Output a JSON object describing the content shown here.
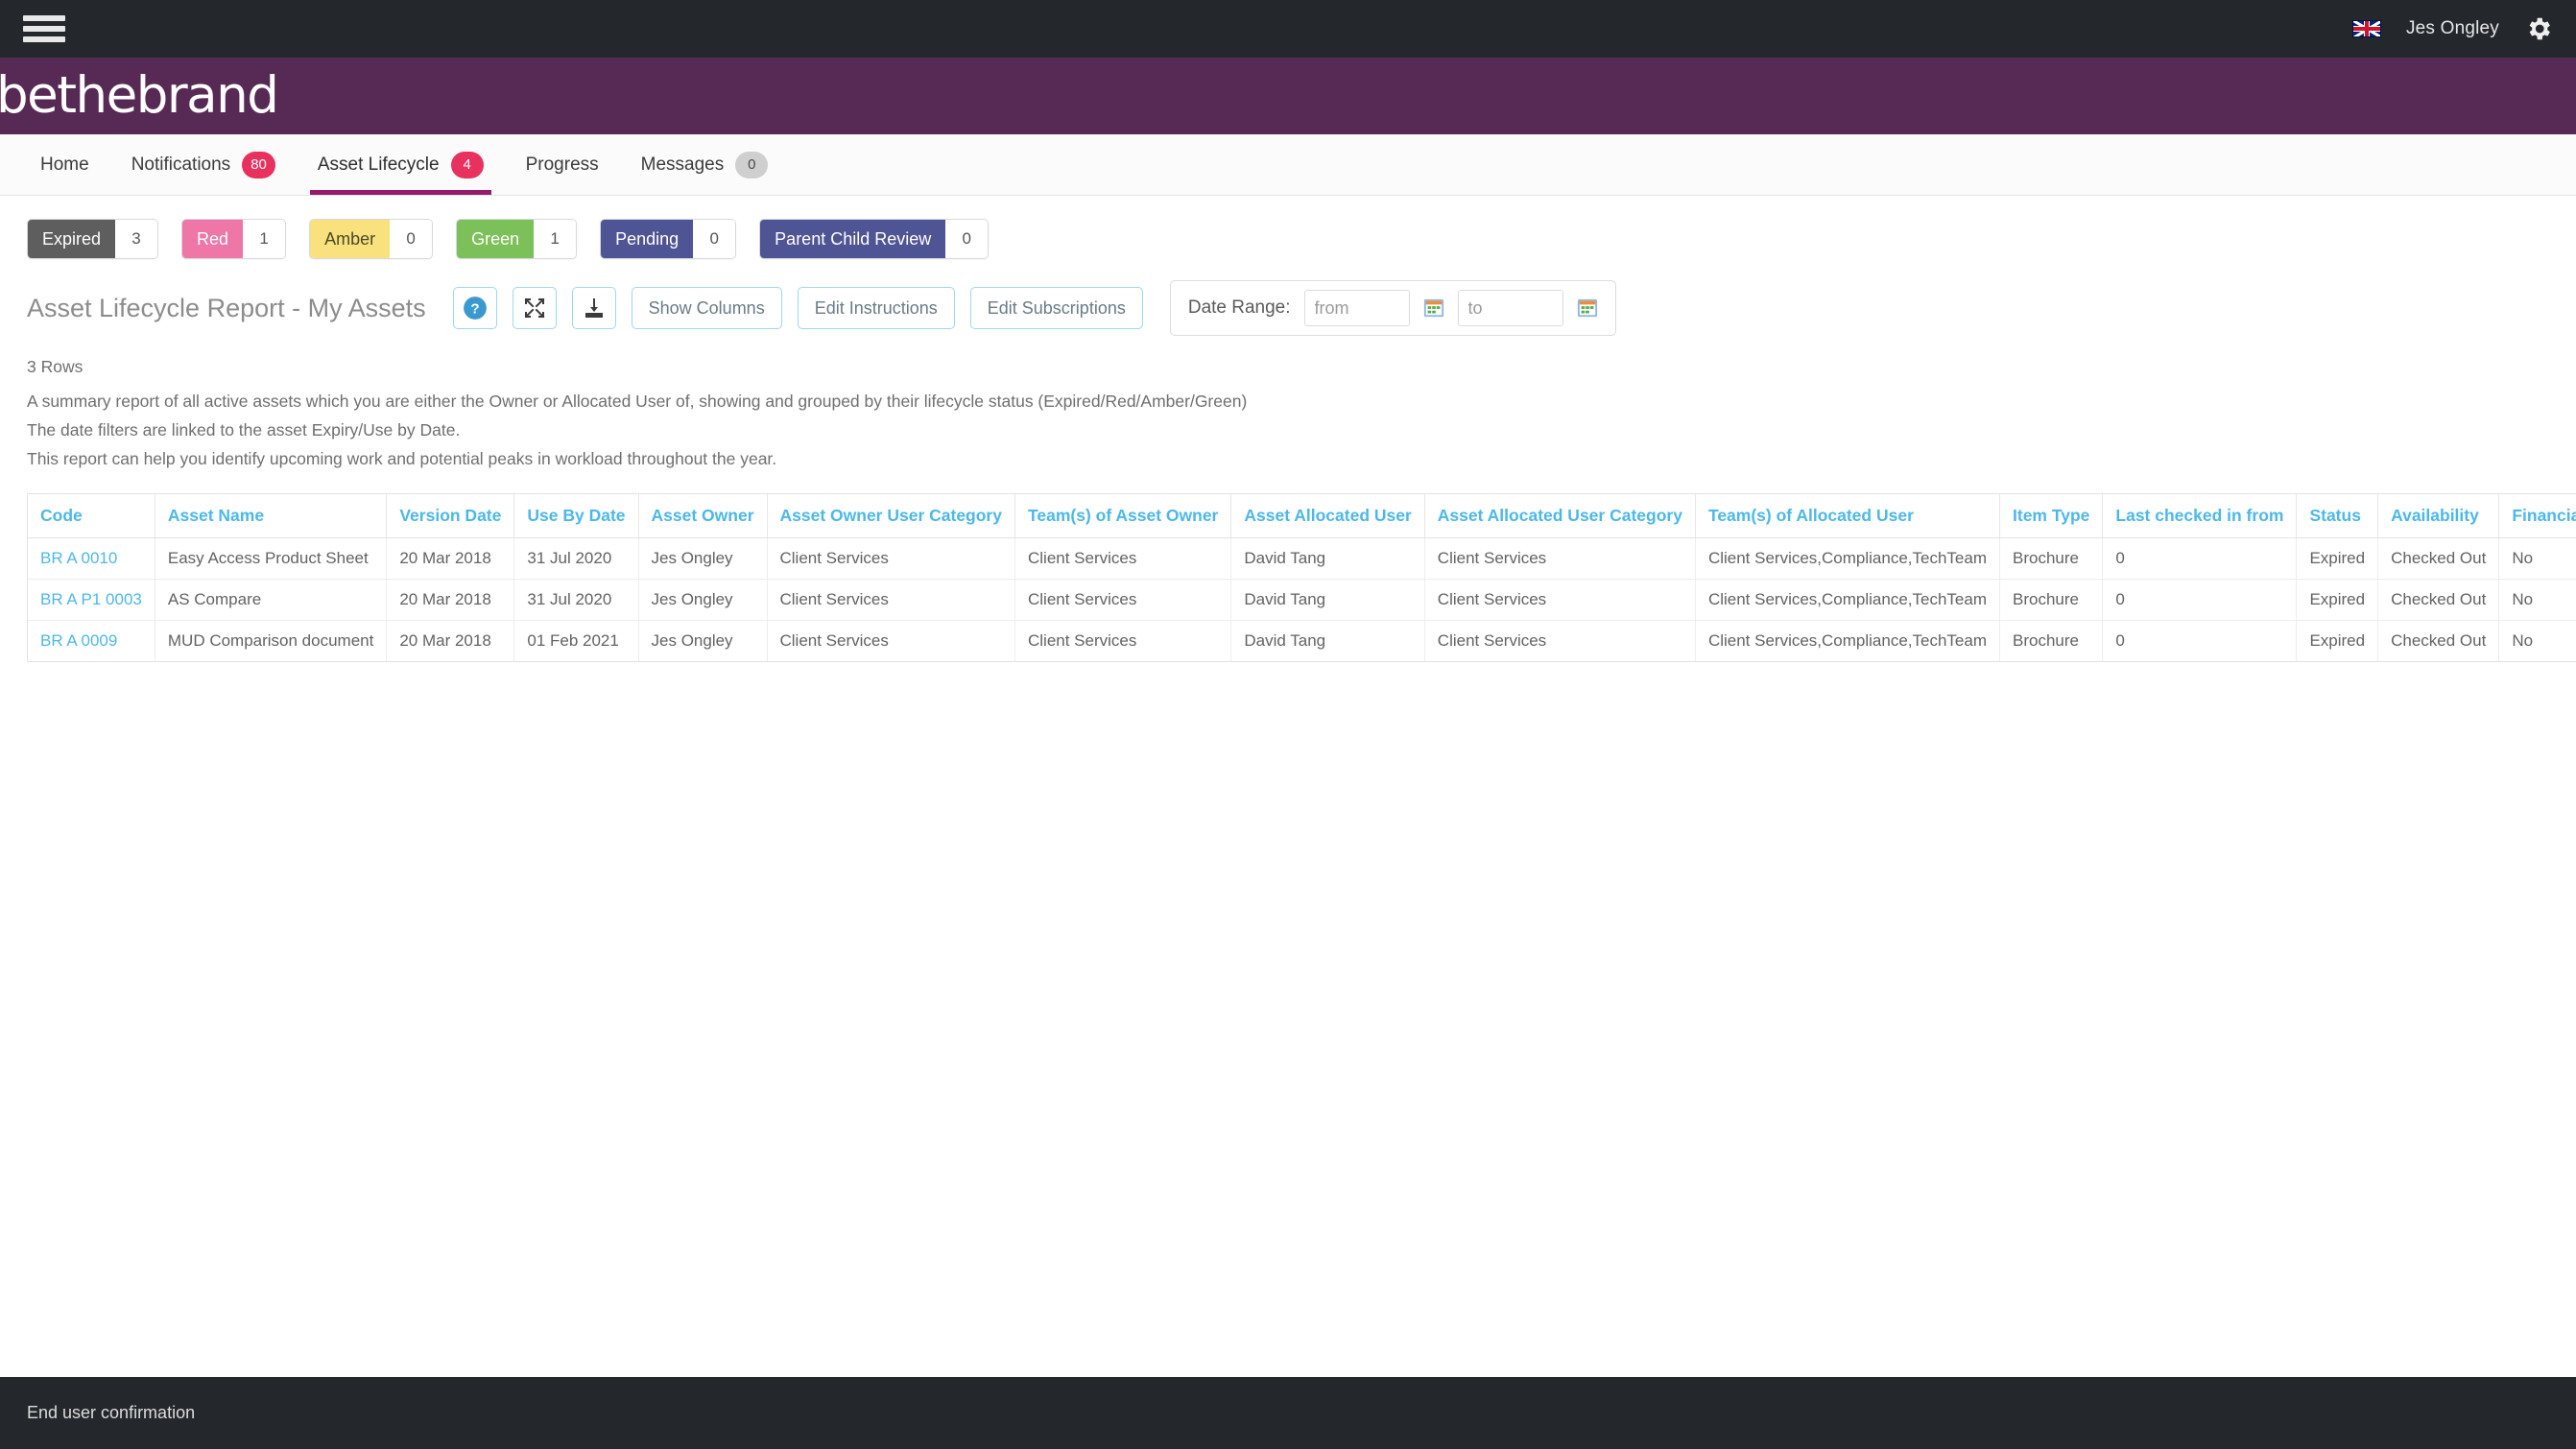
{
  "topbar": {
    "menu_icon": "hamburger-icon",
    "language_flag": "uk-flag-icon",
    "username": "Jes Ongley",
    "settings_icon": "gear-icon"
  },
  "brand": {
    "logo_text": "bethebrand"
  },
  "nav": {
    "tabs": [
      {
        "label": "Home",
        "badge": null,
        "badge_style": null,
        "active": false
      },
      {
        "label": "Notifications",
        "badge": "80",
        "badge_style": "pink",
        "active": false
      },
      {
        "label": "Asset Lifecycle",
        "badge": "4",
        "badge_style": "pink",
        "active": true
      },
      {
        "label": "Progress",
        "badge": null,
        "badge_style": null,
        "active": false
      },
      {
        "label": "Messages",
        "badge": "0",
        "badge_style": "grey",
        "active": false
      }
    ]
  },
  "filters": [
    {
      "label": "Expired",
      "count": "3",
      "color": "#5e5e5e"
    },
    {
      "label": "Red",
      "count": "1",
      "color": "#ee77a8"
    },
    {
      "label": "Amber",
      "count": "0",
      "color": "#f9e27d"
    },
    {
      "label": "Green",
      "count": "1",
      "color": "#7cc05a"
    },
    {
      "label": "Pending",
      "count": "0",
      "color": "#4f5494"
    },
    {
      "label": "Parent Child Review",
      "count": "0",
      "color": "#4f5494"
    }
  ],
  "toolbar": {
    "report_title": "Asset Lifecycle Report - My Assets",
    "help_icon": "help-circle-icon",
    "collapse_icon": "collapse-arrows-icon",
    "download_icon": "download-icon",
    "show_columns_label": "Show Columns",
    "edit_instructions_label": "Edit Instructions",
    "edit_subscriptions_label": "Edit Subscriptions",
    "date_range_label": "Date Range:",
    "date_from_placeholder": "from",
    "date_from_value": "",
    "date_to_placeholder": "to",
    "date_to_value": "",
    "calendar_icon": "calendar-icon"
  },
  "description": {
    "row_count": "3 Rows",
    "line1": "A summary report of all active assets which you are either the Owner or Allocated User of, showing and grouped by their lifecycle status (Expired/Red/Amber/Green)",
    "line2": "The date filters are linked to the asset Expiry/Use by Date.",
    "line3": "This report can help you identify upcoming work and potential peaks in workload throughout the year."
  },
  "table": {
    "columns": [
      "Code",
      "Asset Name",
      "Version Date",
      "Use By Date",
      "Asset Owner",
      "Asset Owner User Category",
      "Team(s) of Asset Owner",
      "Asset Allocated User",
      "Asset Allocated User Category",
      "Team(s) of Allocated User",
      "Item Type",
      "Last checked in from",
      "Status",
      "Availability",
      "Financial Promotion"
    ],
    "rows": [
      {
        "code": "BR A 0010",
        "asset_name": "Easy Access Product Sheet",
        "version_date": "20 Mar 2018",
        "use_by_date": "31 Jul 2020",
        "asset_owner": "Jes Ongley",
        "asset_owner_user_category": "Client Services",
        "teams_of_asset_owner": "Client Services",
        "asset_allocated_user": "David Tang",
        "asset_allocated_user_category": "Client Services",
        "teams_of_allocated_user": "Client Services,Compliance,TechTeam",
        "item_type": "Brochure",
        "last_checked_in_from": "0",
        "status": "Expired",
        "availability": "Checked Out",
        "financial_promotion": "No"
      },
      {
        "code": "BR A P1 0003",
        "asset_name": "AS Compare",
        "version_date": "20 Mar 2018",
        "use_by_date": "31 Jul 2020",
        "asset_owner": "Jes Ongley",
        "asset_owner_user_category": "Client Services",
        "teams_of_asset_owner": "Client Services",
        "asset_allocated_user": "David Tang",
        "asset_allocated_user_category": "Client Services",
        "teams_of_allocated_user": "Client Services,Compliance,TechTeam",
        "item_type": "Brochure",
        "last_checked_in_from": "0",
        "status": "Expired",
        "availability": "Checked Out",
        "financial_promotion": "No"
      },
      {
        "code": "BR A 0009",
        "asset_name": "MUD Comparison document",
        "version_date": "20 Mar 2018",
        "use_by_date": "01 Feb 2021",
        "asset_owner": "Jes Ongley",
        "asset_owner_user_category": "Client Services",
        "teams_of_asset_owner": "Client Services",
        "asset_allocated_user": "David Tang",
        "asset_allocated_user_category": "Client Services",
        "teams_of_allocated_user": "Client Services,Compliance,TechTeam",
        "item_type": "Brochure",
        "last_checked_in_from": "0",
        "status": "Expired",
        "availability": "Checked Out",
        "financial_promotion": "No"
      }
    ]
  },
  "footer": {
    "text": "End user confirmation"
  },
  "colors": {
    "topbar": "#24282c",
    "brandbar": "#572a55",
    "active_tab_underline": "#951b6d",
    "badge_pink": "#e8315f",
    "badge_grey": "#cfcfcf",
    "link_blue": "#4cb8ea",
    "button_border": "#9fd7f0"
  }
}
